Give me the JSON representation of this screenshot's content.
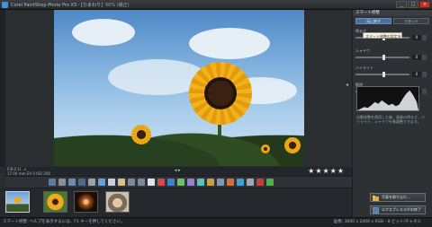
{
  "titlebar": {
    "title": "Corel PaintShop Photo Pro X3 - [ひまわり]",
    "zoom": "50% (補正)",
    "buttons": [
      "_",
      "□",
      "×"
    ]
  },
  "info": {
    "meta_line1": "F/8.0  1/...s",
    "meta_line2": "17.00 mm  EV 0  ISO 200",
    "nav": "◂ ▸",
    "rating": 5
  },
  "right_panel": {
    "header": "スマート修整",
    "tabs": [
      "元に戻す",
      "リセット"
    ],
    "tooltip": "スマート修整の設定を使用",
    "sliders": [
      {
        "label": "明るさ",
        "value": "0",
        "pos": 0.5
      },
      {
        "label": "シャドウ",
        "value": "0",
        "pos": 0.5
      },
      {
        "label": "ハイライト",
        "value": "0",
        "pos": 0.5
      },
      {
        "label": "鮮明",
        "value": "0",
        "pos": 0.5
      }
    ],
    "description": "自動修整を適用した後、画像の明るさ、ハイライト、シャドウを微調整できます。",
    "buttons": {
      "import": "写真を取り込む…",
      "express": "エクスプレスラボの終了"
    }
  },
  "statusbar": {
    "left": "スマート修整: ヘルプを表示するには、F1 キーを押してください。",
    "right": "画像: 3600 x 2400 x RGB - 8 ビット/チャネル"
  },
  "filmstrip": {
    "thumbs": [
      "sunflower-field",
      "sunflower-close",
      "fireworks",
      "portrait"
    ]
  }
}
